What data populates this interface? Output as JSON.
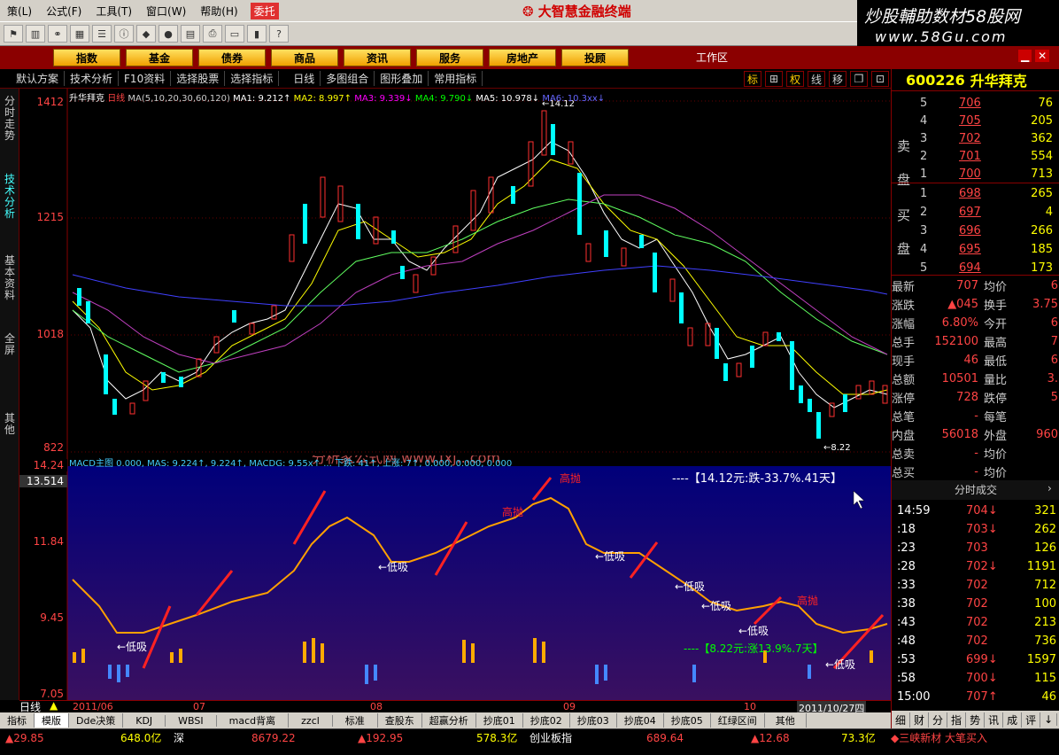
{
  "menu": {
    "items": [
      "策(L)",
      "公式(F)",
      "工具(T)",
      "窗口(W)",
      "帮助(H)"
    ],
    "hot": "委托"
  },
  "brand": {
    "title": "大智慧金融终端",
    "logo_line1": "炒股輔助数材58股网",
    "logo_line2": "www.58Gu.com"
  },
  "nav": {
    "buttons": [
      "指数",
      "基金",
      "债券",
      "商品",
      "资讯",
      "服务",
      "房地产",
      "投顾"
    ],
    "workarea": "工作区"
  },
  "subbar": {
    "items": [
      "默认方案",
      "技术分析",
      "F10资料",
      "选择股票",
      "选择指标",
      "日线",
      "多图组合",
      "图形叠加",
      "常用指标"
    ],
    "right_btns": [
      "标",
      "⊞",
      "权",
      "线",
      "移",
      "❐",
      "⊡"
    ]
  },
  "left_tabs": {
    "t1": "分时走势",
    "t2": "技术分析",
    "t3": "基本资料",
    "t4": "全屏",
    "t5": "其他"
  },
  "main_chart": {
    "axis": [
      "1412",
      "1215",
      "1018",
      "822"
    ],
    "legend": {
      "name": "升华拜克",
      "period": "日线",
      "ma": "MA(5,10,20,30,60,120)",
      "ma1": "MA1: 9.212↑",
      "ma2": "MA2: 8.997↑",
      "ma3": "MA3: 9.339↓",
      "ma4": "MA4: 9.790↓",
      "ma5": "MA5: 10.978↓",
      "ma6": "MA6: 10.3xx↓"
    },
    "peak_label": "←14.12",
    "low_label": "←8.22"
  },
  "low_chart": {
    "axis": [
      "14.24",
      "13.514",
      "11.84",
      "9.45",
      "7.05"
    ],
    "legend": "MACD主图 0.000, MAS: 9.224↑, 9.224↑, MACDG: 9.55x↑ ... 下跌: 41↑, 上涨: 7↑, 0.000, 0.000, 0.000",
    "watermark": "分析家公式网 www.fxj...com",
    "note_top": "----【14.12元:跌-33.7%.41天】",
    "note_bottom": "----【8.22元:涨13.9%.7天】",
    "labels": {
      "high": "高抛",
      "low": "←低吸"
    }
  },
  "dates": {
    "period": "日线",
    "d1": "2011/06",
    "d2": "07",
    "d3": "08",
    "d4": "09",
    "d5": "10",
    "cursor": "2011/10/27四"
  },
  "tabs": [
    "指标",
    "模版",
    "Dde决策",
    "KDJ",
    "WBSI",
    "macd背离",
    "zzcl",
    "标准",
    "查股东",
    "超赢分析",
    "抄底01",
    "抄底02",
    "抄底03",
    "抄底04",
    "抄底05",
    "红绿区间",
    "其他"
  ],
  "status": {
    "s1": "▲29.85",
    "s2": "648.0亿",
    "s3": "深",
    "s4": "8679.22",
    "s5": "▲192.95",
    "s6": "578.3亿",
    "s7": "创业板指",
    "s8": "689.64",
    "s9": "▲12.68",
    "s10": "73.3亿",
    "s11": "◆三峡新材 大笔买入"
  },
  "quote": {
    "code": "600226",
    "name": "升华拜克",
    "sell_label": [
      "卖",
      "盘"
    ],
    "buy_label": [
      "买",
      "盘"
    ],
    "asks": [
      [
        "5",
        "706",
        "76"
      ],
      [
        "4",
        "705",
        "205"
      ],
      [
        "3",
        "702",
        "362"
      ],
      [
        "2",
        "701",
        "554"
      ],
      [
        "1",
        "700",
        "713"
      ]
    ],
    "bids": [
      [
        "1",
        "698",
        "265"
      ],
      [
        "2",
        "697",
        "4"
      ],
      [
        "3",
        "696",
        "266"
      ],
      [
        "4",
        "695",
        "185"
      ],
      [
        "5",
        "694",
        "173"
      ]
    ],
    "stats": [
      [
        "最新",
        "707",
        "均价",
        "6"
      ],
      [
        "涨跌",
        "▲045",
        "换手",
        "3.75"
      ],
      [
        "涨幅",
        "6.80%",
        "今开",
        "6"
      ],
      [
        "总手",
        "152100",
        "最高",
        "7"
      ],
      [
        "现手",
        "46",
        "最低",
        "6"
      ],
      [
        "总额",
        "10501",
        "量比",
        "3."
      ],
      [
        "涨停",
        "728",
        "跌停",
        "5"
      ],
      [
        "总笔",
        "-",
        "每笔",
        ""
      ],
      [
        "内盘",
        "56018",
        "外盘",
        "960"
      ],
      [
        "总卖",
        "-",
        "均价",
        ""
      ],
      [
        "总买",
        "-",
        "均价",
        ""
      ]
    ],
    "trade_title": "分时成交",
    "trades": [
      [
        "14:59",
        "704↓",
        "321"
      ],
      [
        ":18",
        "703↓",
        "262"
      ],
      [
        ":23",
        "703",
        "126"
      ],
      [
        ":28",
        "702↓",
        "1191"
      ],
      [
        ":33",
        "702",
        "712"
      ],
      [
        ":38",
        "702",
        "100"
      ],
      [
        ":43",
        "702",
        "213"
      ],
      [
        ":48",
        "702",
        "736"
      ],
      [
        ":53",
        "699↓",
        "1597"
      ],
      [
        ":58",
        "700↓",
        "115"
      ],
      [
        "15:00",
        "707↑",
        "46"
      ]
    ],
    "bottom_tabs": [
      "细",
      "财",
      "分",
      "指",
      "势",
      "讯",
      "成",
      "评",
      "↓"
    ]
  }
}
